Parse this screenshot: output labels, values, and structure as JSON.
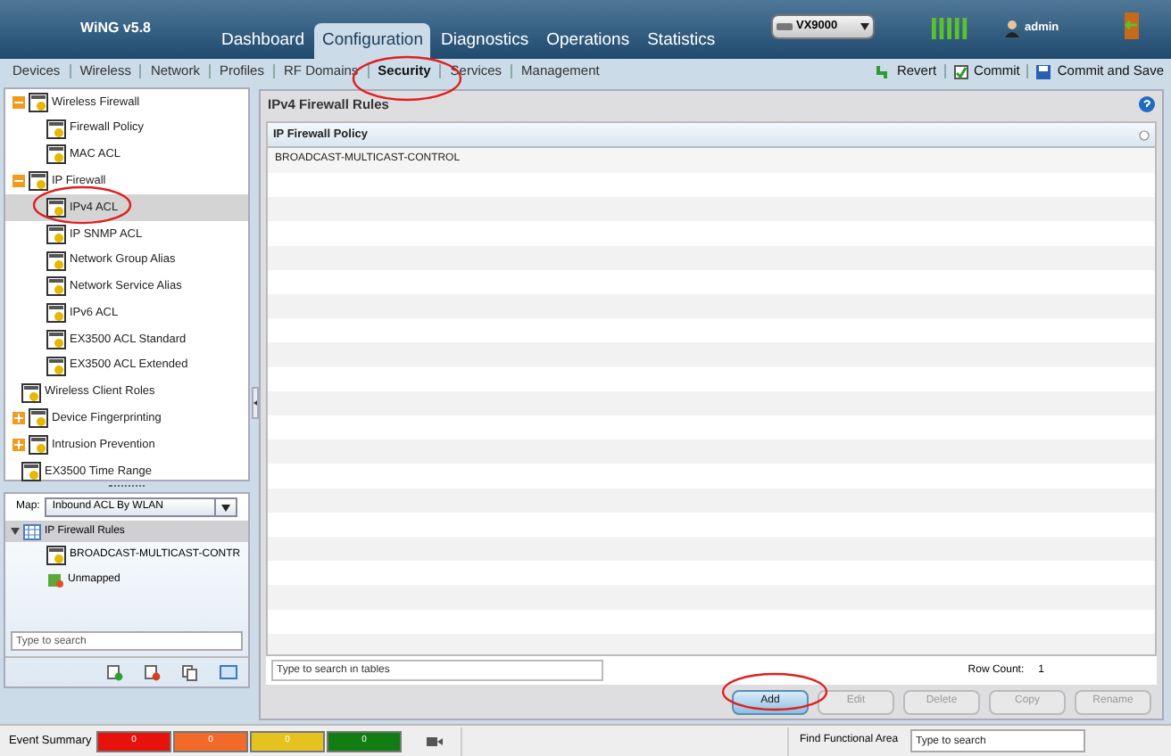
{
  "app": {
    "title": "WiNG v5.8",
    "device": "VX9000",
    "user": "admin"
  },
  "tabs": [
    {
      "label": "Dashboard",
      "selected": false
    },
    {
      "label": "Configuration",
      "selected": true
    },
    {
      "label": "Diagnostics",
      "selected": false
    },
    {
      "label": "Operations",
      "selected": false
    },
    {
      "label": "Statistics",
      "selected": false
    }
  ],
  "subnav": [
    {
      "label": "Devices",
      "selected": false
    },
    {
      "label": "Wireless",
      "selected": false
    },
    {
      "label": "Network",
      "selected": false
    },
    {
      "label": "Profiles",
      "selected": false
    },
    {
      "label": "RF Domains",
      "selected": false
    },
    {
      "label": "Security",
      "selected": true
    },
    {
      "label": "Services",
      "selected": false
    },
    {
      "label": "Management",
      "selected": false
    }
  ],
  "actions": [
    {
      "label": "Revert",
      "kind": "revert"
    },
    {
      "label": "Commit",
      "kind": "commit"
    },
    {
      "label": "Commit and Save",
      "kind": "save"
    }
  ],
  "tree": [
    {
      "label": "Wireless Firewall",
      "expanded": true,
      "selected": false,
      "children": [
        {
          "label": "Firewall Policy",
          "selected": false
        },
        {
          "label": "MAC ACL",
          "selected": false
        }
      ]
    },
    {
      "label": "IP Firewall",
      "expanded": true,
      "selected": false,
      "children": [
        {
          "label": "IPv4 ACL",
          "selected": true
        },
        {
          "label": "IP SNMP ACL",
          "selected": false
        },
        {
          "label": "Network Group Alias",
          "selected": false
        },
        {
          "label": "Network Service Alias",
          "selected": false
        },
        {
          "label": "IPv6 ACL",
          "selected": false
        },
        {
          "label": "EX3500 ACL Standard",
          "selected": false
        },
        {
          "label": "EX3500 ACL Extended",
          "selected": false
        }
      ]
    },
    {
      "label": "Wireless Client Roles",
      "selected": false
    },
    {
      "label": "Device Fingerprinting",
      "expanded": false,
      "selected": false
    },
    {
      "label": "Intrusion Prevention",
      "expanded": false,
      "selected": false
    },
    {
      "label": "EX3500 Time Range",
      "selected": false
    }
  ],
  "map": {
    "label": "Map:",
    "value": "Inbound ACL By WLAN",
    "group": "IP Firewall Rules",
    "items": [
      "BROADCAST-MULTICAST-CONTR",
      "Unmapped"
    ],
    "search_placeholder": "Type to search"
  },
  "panel": {
    "title": "IPv4 Firewall Rules",
    "column": "IP Firewall Policy",
    "rows": [
      "BROADCAST-MULTICAST-CONTROL"
    ],
    "search_placeholder": "Type to search in tables",
    "row_count_label": "Row Count:",
    "row_count": "1"
  },
  "buttons": [
    {
      "label": "Add",
      "disabled": false
    },
    {
      "label": "Edit",
      "disabled": true
    },
    {
      "label": "Delete",
      "disabled": true
    },
    {
      "label": "Copy",
      "disabled": true
    },
    {
      "label": "Rename",
      "disabled": true
    }
  ],
  "status": {
    "label": "Event Summary",
    "counters": [
      {
        "value": "0",
        "color": "#e8120c"
      },
      {
        "value": "0",
        "color": "#f26a2a"
      },
      {
        "value": "0",
        "color": "#e5c21f"
      },
      {
        "value": "0",
        "color": "#127d13"
      }
    ],
    "find_label": "Find Functional Area",
    "find_placeholder": "Type to search"
  }
}
